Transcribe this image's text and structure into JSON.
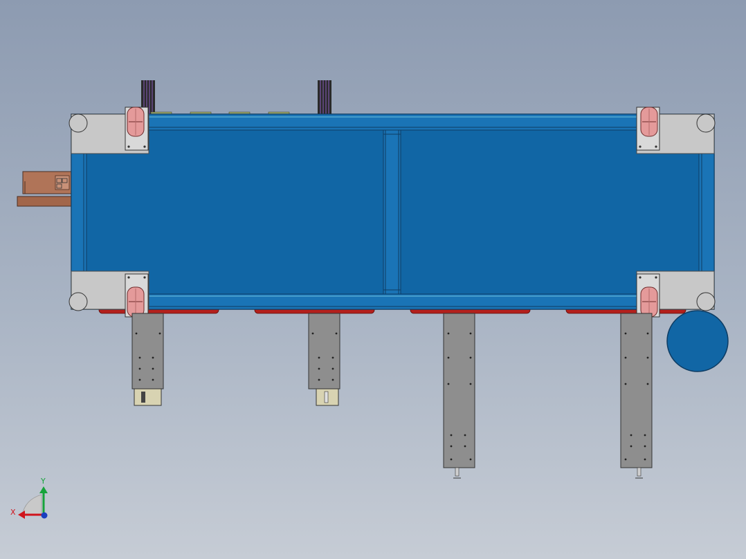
{
  "viewport": {
    "background_top": "#8d9bb1",
    "background_bottom": "#c6ccd5"
  },
  "model": {
    "frame_color": "#1166a5",
    "frame_edge": "#0e3c63",
    "steel_color": "#8e8e8e",
    "corner_plate_color": "#c8c8c8",
    "pad_color": "#b3201c",
    "caster_color": "#e49a9a",
    "motor_color": "#1166a5",
    "gearbox_color": "#b07458",
    "bracket_color": "#d8d3b2",
    "cable_color": "#3b2c55",
    "leg_count": 4,
    "caster_count": 4
  },
  "triad": {
    "x_label": "X",
    "y_label": "Y",
    "x_color": "#d0141c",
    "y_color": "#16a33a",
    "z_color": "#1a3fbf"
  }
}
